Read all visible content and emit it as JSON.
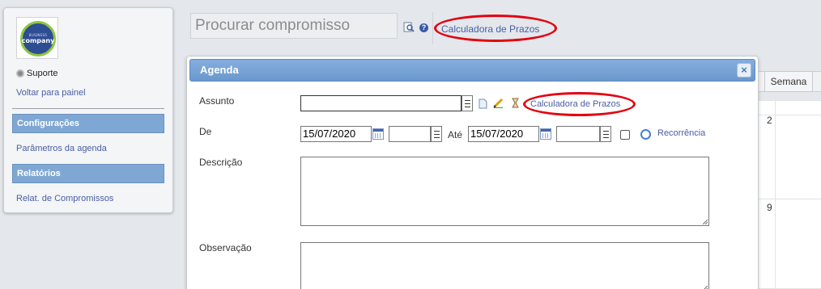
{
  "sidebar": {
    "logo": {
      "small_text": "BUSINESS",
      "text": "company"
    },
    "support_label": "Suporte",
    "back_link": "Voltar para painel",
    "sections": [
      {
        "title": "Configurações",
        "link": "Parâmetros da agenda"
      },
      {
        "title": "Relatórios",
        "link": "Relat. de Compromissos"
      }
    ]
  },
  "topbar": {
    "search_placeholder": "Procurar compromisso",
    "help_glyph": "?",
    "calculator_link": "Calculadora de Prazos"
  },
  "calendar": {
    "view_tab": "Semana",
    "day_numbers": [
      "2",
      "9"
    ]
  },
  "modal": {
    "title": "Agenda",
    "close_glyph": "×",
    "assunto_label": "Assunto",
    "assunto_value": "",
    "calculator_link": "Calculadora de Prazos",
    "de_label": "De",
    "start_date": "15/07/2020",
    "start_time": "",
    "ate_label": "Até",
    "end_date": "15/07/2020",
    "end_time": "",
    "recurrence_label": "Recorrência",
    "descricao_label": "Descrição",
    "observacao_label": "Observação"
  },
  "colors": {
    "accent_link": "#4a5ea5",
    "section_header": "#7fa7d3",
    "modal_header": "#6b98cc",
    "highlight_ring": "#e3000f"
  }
}
